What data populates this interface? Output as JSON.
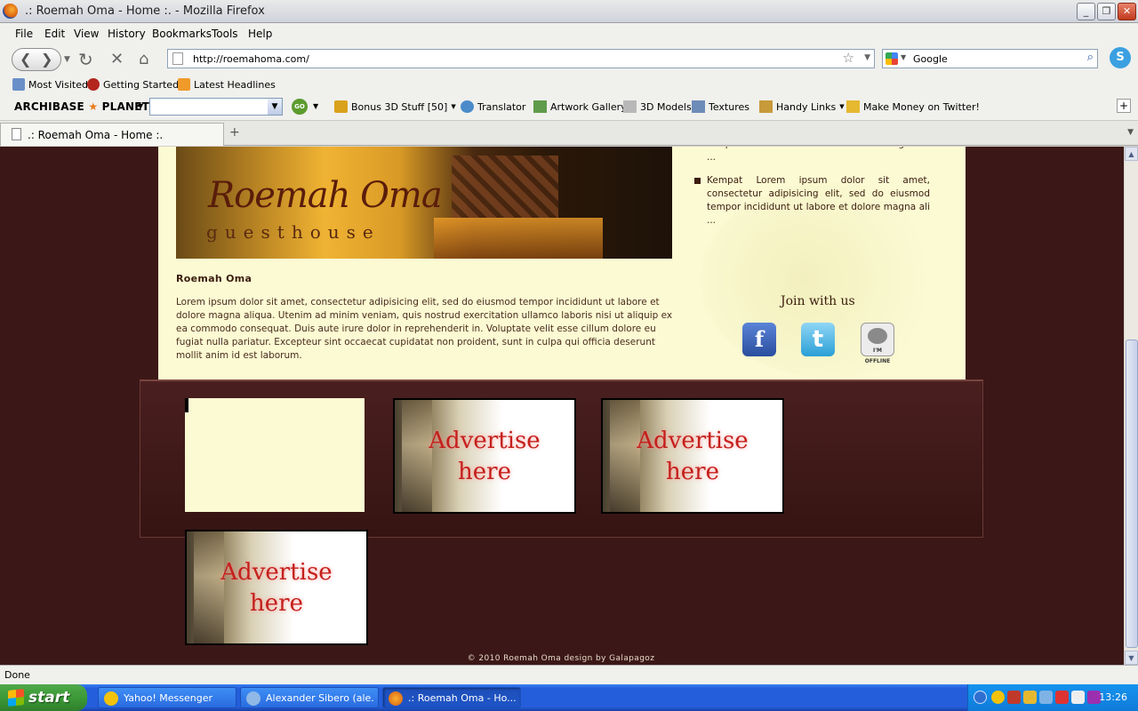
{
  "window": {
    "title": ".: Roemah Oma - Home :. - Mozilla Firefox"
  },
  "menu": [
    "File",
    "Edit",
    "View",
    "History",
    "Bookmarks",
    "Tools",
    "Help"
  ],
  "nav": {
    "url": "http://roemahoma.com/",
    "search_value": "Google"
  },
  "bookmarks": [
    "Most Visited",
    "Getting Started",
    "Latest Headlines"
  ],
  "archibase": {
    "logo_left": "ARCHIBASE",
    "logo_star": "★",
    "logo_right": "PLANET",
    "go": "GO",
    "items": [
      "Bonus 3D Stuff [50]",
      "Translator",
      "Artwork Gallery",
      "3D Models",
      "Textures",
      "Handy Links",
      "Make Money on Twitter!"
    ]
  },
  "tabs": [
    {
      "label": ".: Roemah Oma - Home :."
    }
  ],
  "page": {
    "hero": {
      "logo_script": "Roemah Oma",
      "logo_sub": "guesthouse"
    },
    "post_title": "Roemah Oma",
    "post_body": "Lorem ipsum dolor sit amet, consectetur adipisicing elit, sed do eiusmod tempor incididunt ut labore et dolore magna aliqua. Utenim ad minim veniam, quis nostrud exercitation ullamco laboris nisi ut aliquip ex ea commodo consequat. Duis aute irure dolor in reprehenderit in. Voluptate velit esse cillum dolore eu fugiat nulla pariatur. Excepteur sint occaecat cupidatat non proident, sunt in culpa qui officia deserunt mollit anim id est laborum.",
    "sidebar_items": [
      "tempor incididunt ut labore et dolore magna ali ...",
      "Kempat Lorem ipsum dolor sit amet, consectetur adipisicing elit, sed do eiusmod tempor incididunt ut labore et dolore magna ali ..."
    ],
    "join_title": "Join with us",
    "social": {
      "facebook": "f",
      "twitter": "t",
      "ym": "I'M OFFLINE"
    },
    "ads": [
      {
        "line1": "Advertise",
        "line2": "here"
      },
      {
        "line1": "Advertise",
        "line2": "here"
      },
      {
        "line1": "Advertise",
        "line2": "here"
      }
    ],
    "footer": "© 2010 Roemah Oma design by Galapagoz"
  },
  "status": "Done",
  "taskbar": {
    "start": "start",
    "tasks": [
      "Yahoo! Messenger",
      "Alexander Sibero (ale...",
      ".: Roemah Oma - Ho..."
    ],
    "clock": "13:26"
  },
  "colors": {
    "page_bg": "#3b1817",
    "cream": "#fbfad3",
    "ad_text": "#c4201c"
  }
}
